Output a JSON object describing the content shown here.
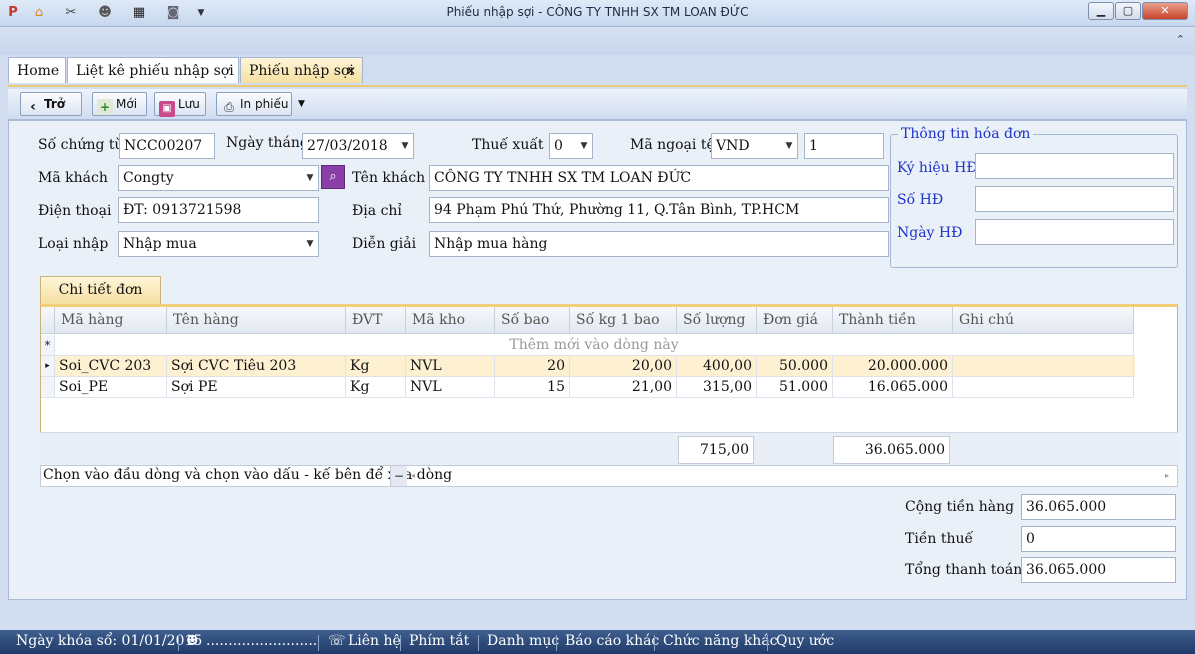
{
  "window": {
    "title": "Phiếu nhập sợi - CÔNG TY TNHH SX TM LOAN ĐỨC"
  },
  "tabs": [
    "Home",
    "Liệt kê phiếu  nhập sợi",
    "Phiếu nhập sợi"
  ],
  "toolbar": {
    "back": "Trở lại",
    "new": "Mới",
    "save": "Lưu",
    "print": "In phiếu"
  },
  "form": {
    "voucher_no_label": "Số chứng từ",
    "voucher_no": "NCC00207",
    "date_label": "Ngày tháng",
    "date": "27/03/2018",
    "tax_label": "Thuế xuất",
    "tax": "0",
    "currency_label": "Mã ngoại tệ",
    "currency": "VND",
    "rate": "1",
    "customer_code_label": "Mã khách",
    "customer_code": "Congty",
    "customer_name_label": "Tên khách",
    "customer_name": "CÔNG TY TNHH SX TM LOAN ĐỨC",
    "phone_label": "Điện thoại",
    "phone": "ĐT: 0913721598",
    "address_label": "Địa chỉ",
    "address": "94 Phạm Phú Thứ, Phường 11, Q.Tân Bình, TP.HCM",
    "import_type_label": "Loại nhập",
    "import_type": "Nhập mua",
    "note_label": "Diễn giải",
    "note": "Nhập mua hàng"
  },
  "invoice": {
    "title": "Thông tin hóa đơn",
    "symbol_label": "Ký hiệu HĐ",
    "symbol": "",
    "number_label": "Số HĐ",
    "number": "",
    "date_label": "Ngày HĐ",
    "date": ""
  },
  "detail": {
    "tab": "Chi tiết đơn hàng",
    "columns": [
      "Mã hàng",
      "Tên hàng",
      "ĐVT",
      "Mã kho",
      "Số bao",
      "Số kg 1 bao",
      "Số lượng",
      "Đơn giá",
      "Thành tiền",
      "Ghi chú"
    ],
    "new_row_marker": "*",
    "new_row_text": "Thêm mới vào dòng này",
    "rows": [
      [
        "Soi_CVC 203",
        "Sợi CVC Tiêu 203",
        "Kg",
        "NVL",
        "20",
        "20,00",
        "400,00",
        "50.000",
        "20.000.000",
        ""
      ],
      [
        "Soi_PE",
        "Sợi PE",
        "Kg",
        "NVL",
        "15",
        "21,00",
        "315,00",
        "51.000",
        "16.065.000",
        ""
      ]
    ],
    "total_qty": "715,00",
    "total_amount": "36.065.000",
    "hint": "Chọn vào đầu dòng và chọn vào dấu - kế bên để xóa dòng",
    "collapse": "−"
  },
  "summary": {
    "subtotal_label": "Cộng tiền hàng",
    "subtotal": "36.065.000",
    "tax_label": "Tiền thuế",
    "tax": "0",
    "total_label": "Tổng thanh toán",
    "total": "36.065.000"
  },
  "status": {
    "lock_date": "Ngày khóa sổ: 01/01/2015",
    "user": ".........................",
    "contact": "Liên hệ",
    "shortcut": "Phím tắt",
    "catalog": "Danh mục",
    "reports": "Báo cáo khác",
    "functions": "Chức năng khác",
    "rules": "Quy ước"
  },
  "colors": {
    "accent": "#f0cf78",
    "invoice_title": "#1d33c9",
    "statusbar": "#2a4676"
  }
}
